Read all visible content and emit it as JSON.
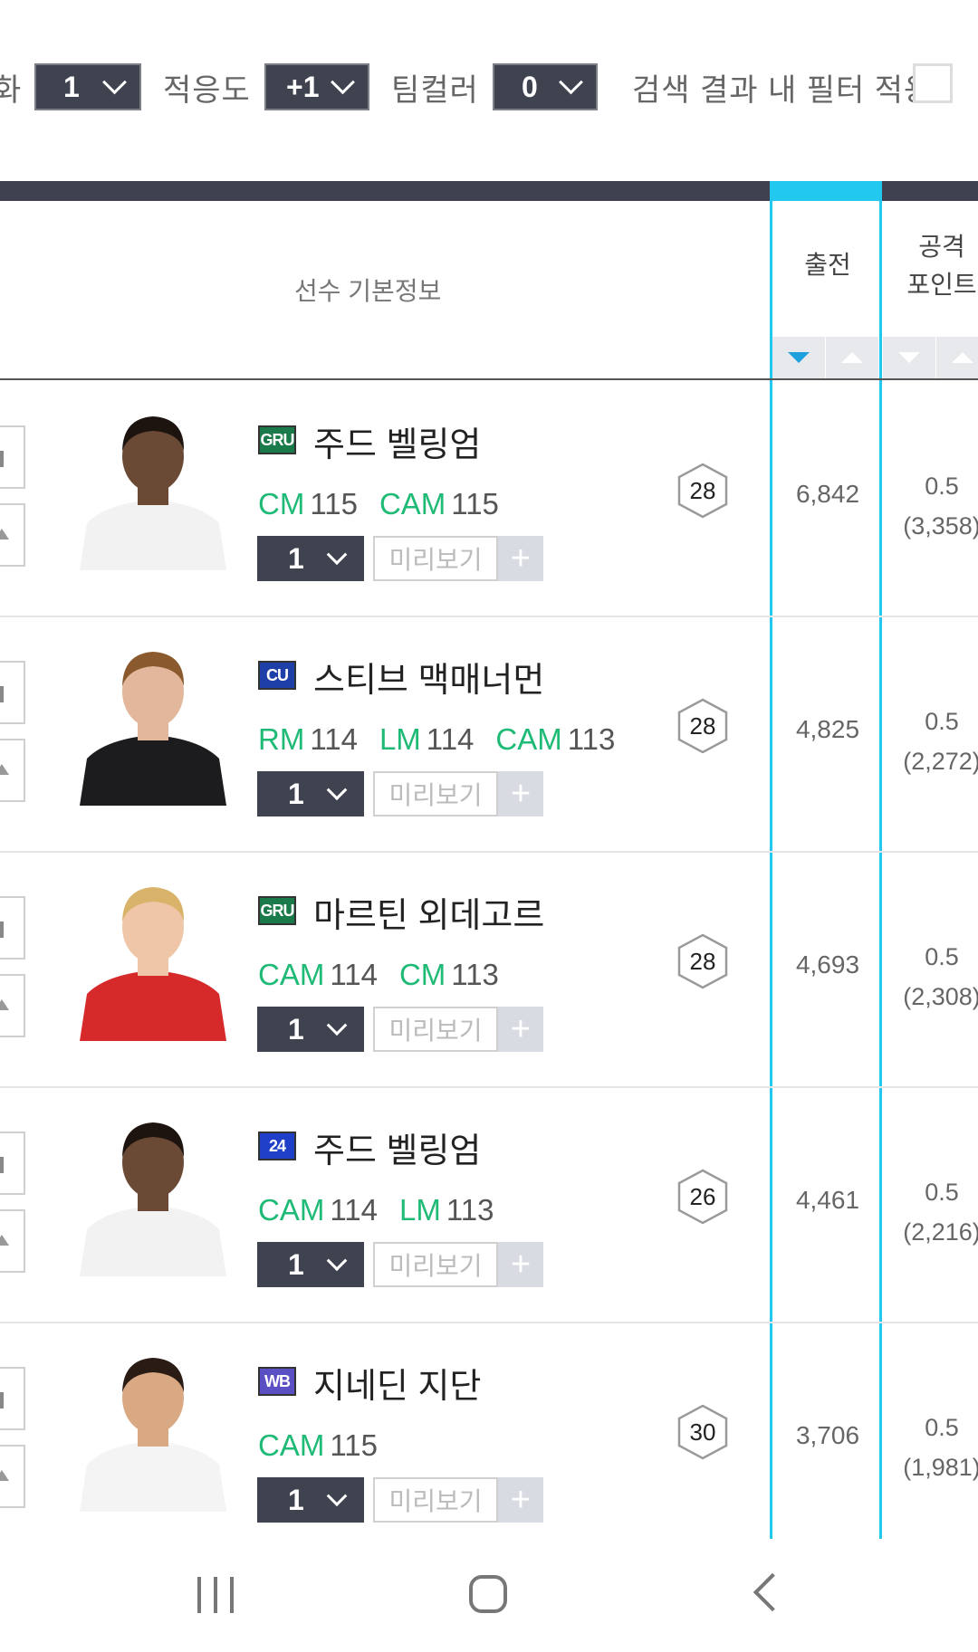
{
  "filters": {
    "cut_label": "화",
    "reinforce_value": "1",
    "adaptability_label": "적응도",
    "adaptability_value": "+1",
    "teamcolor_label": "팀컬러",
    "teamcolor_value": "0",
    "apply_filter_label": "검색 결과 내 필터 적용"
  },
  "table": {
    "header": {
      "player_info": "선수 기본정보",
      "games_col": "출전",
      "attack_col_line1": "공격",
      "attack_col_line2": "포인트"
    },
    "row_controls": {
      "preview_label": "미리보기",
      "plus_label": "+"
    },
    "rows": [
      {
        "season": "GRU",
        "season_color": "#1a7a4a",
        "name": "주드 벨링엄",
        "positions": [
          {
            "pos": "CM",
            "ovr": "115"
          },
          {
            "pos": "CAM",
            "ovr": "115"
          }
        ],
        "level": "1",
        "salary": "28",
        "games": "6,842",
        "attack": "0.5",
        "attack_total": "(3,358)"
      },
      {
        "season": "CU",
        "season_color": "#1f3fa8",
        "name": "스티브 맥매너먼",
        "positions": [
          {
            "pos": "RM",
            "ovr": "114"
          },
          {
            "pos": "LM",
            "ovr": "114"
          },
          {
            "pos": "CAM",
            "ovr": "113"
          }
        ],
        "level": "1",
        "salary": "28",
        "games": "4,825",
        "attack": "0.5",
        "attack_total": "(2,272)"
      },
      {
        "season": "GRU",
        "season_color": "#1a7a4a",
        "name": "마르틴 외데고르",
        "positions": [
          {
            "pos": "CAM",
            "ovr": "114"
          },
          {
            "pos": "CM",
            "ovr": "113"
          }
        ],
        "level": "1",
        "salary": "28",
        "games": "4,693",
        "attack": "0.5",
        "attack_total": "(2,308)"
      },
      {
        "season": "24",
        "season_color": "#1f3fc8",
        "name": "주드 벨링엄",
        "positions": [
          {
            "pos": "CAM",
            "ovr": "114"
          },
          {
            "pos": "LM",
            "ovr": "113"
          }
        ],
        "level": "1",
        "salary": "26",
        "games": "4,461",
        "attack": "0.5",
        "attack_total": "(2,216)"
      },
      {
        "season": "WB",
        "season_color": "#5b4fc4",
        "name": "지네딘 지단",
        "positions": [
          {
            "pos": "CAM",
            "ovr": "115"
          }
        ],
        "level": "1",
        "salary": "30",
        "games": "3,706",
        "attack": "0.5",
        "attack_total": "(1,981)"
      }
    ]
  },
  "navbar": {
    "recent_icon": "recent-apps-icon",
    "home_icon": "home-icon",
    "back_icon": "back-icon"
  }
}
